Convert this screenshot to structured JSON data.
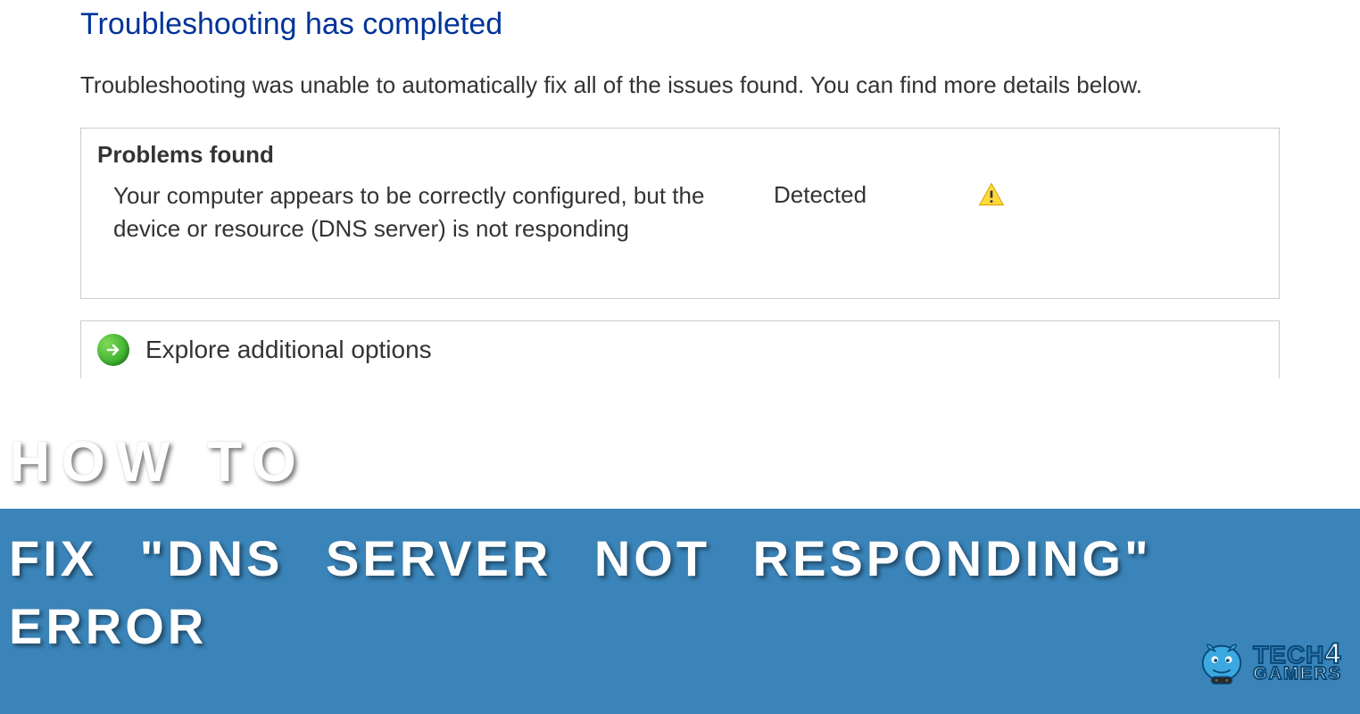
{
  "dialog": {
    "title": "Troubleshooting has completed",
    "subtitle": "Troubleshooting was unable to automatically fix all of the issues found. You can find more details below.",
    "problemsHeader": "Problems found",
    "problems": [
      {
        "text": "Your computer appears to be correctly configured, but the device or resource (DNS server) is not responding",
        "status": "Detected",
        "iconType": "warning"
      }
    ],
    "exploreLabel": "Explore additional options"
  },
  "overlay": {
    "howto": "HOW TO",
    "bannerText": "FIX \"DNS SERVER NOT RESPONDING\" ERROR"
  },
  "logo": {
    "brand1": "TECH",
    "brand4": "4",
    "brand2": "GAMERS"
  },
  "colors": {
    "titleBlue": "#003399",
    "bannerBg": "#3a84b9",
    "textGray": "#333333",
    "border": "#cccccc"
  }
}
